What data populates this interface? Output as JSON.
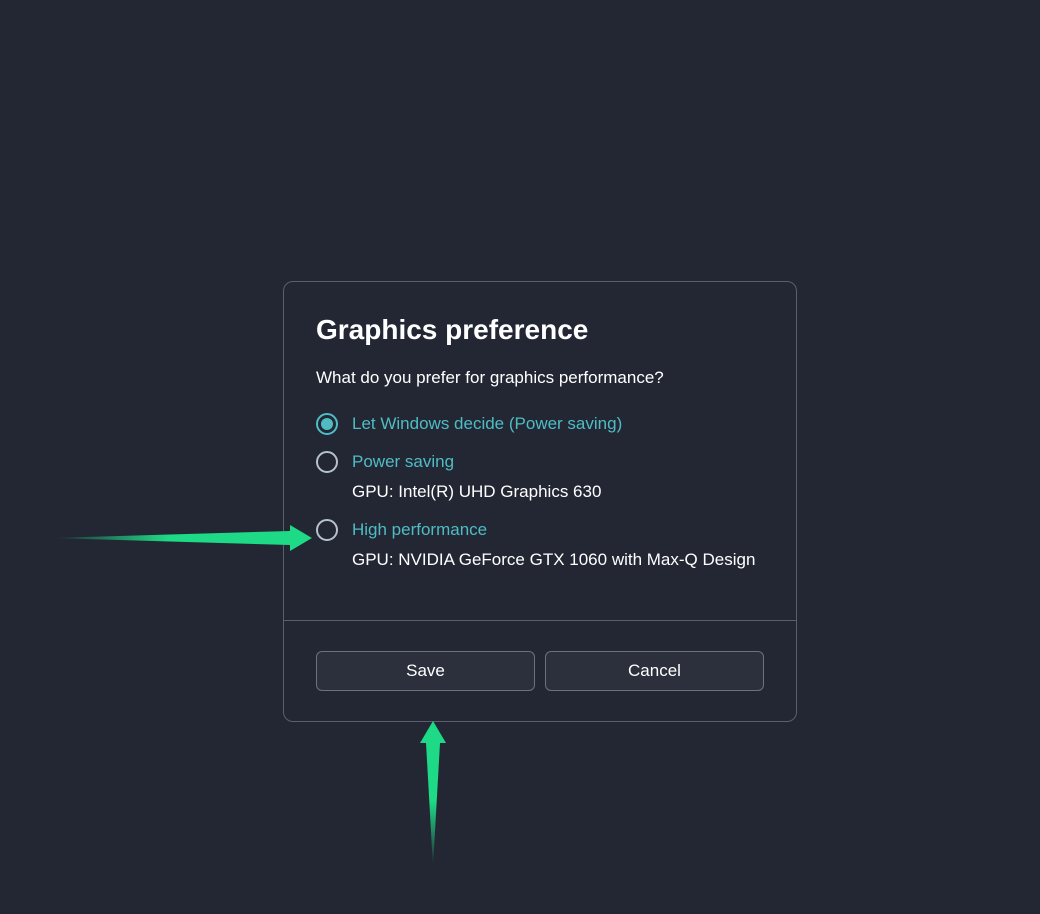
{
  "dialog": {
    "title": "Graphics preference",
    "question": "What do you prefer for graphics performance?",
    "options": [
      {
        "label": "Let Windows decide (Power saving)",
        "sub": null,
        "selected": true
      },
      {
        "label": "Power saving",
        "sub": "GPU: Intel(R) UHD Graphics 630",
        "selected": false
      },
      {
        "label": "High performance",
        "sub": "GPU: NVIDIA GeForce GTX 1060 with Max-Q Design",
        "selected": false
      }
    ],
    "save_label": "Save",
    "cancel_label": "Cancel"
  },
  "annotations": {
    "arrow_color": "#1ed986"
  }
}
